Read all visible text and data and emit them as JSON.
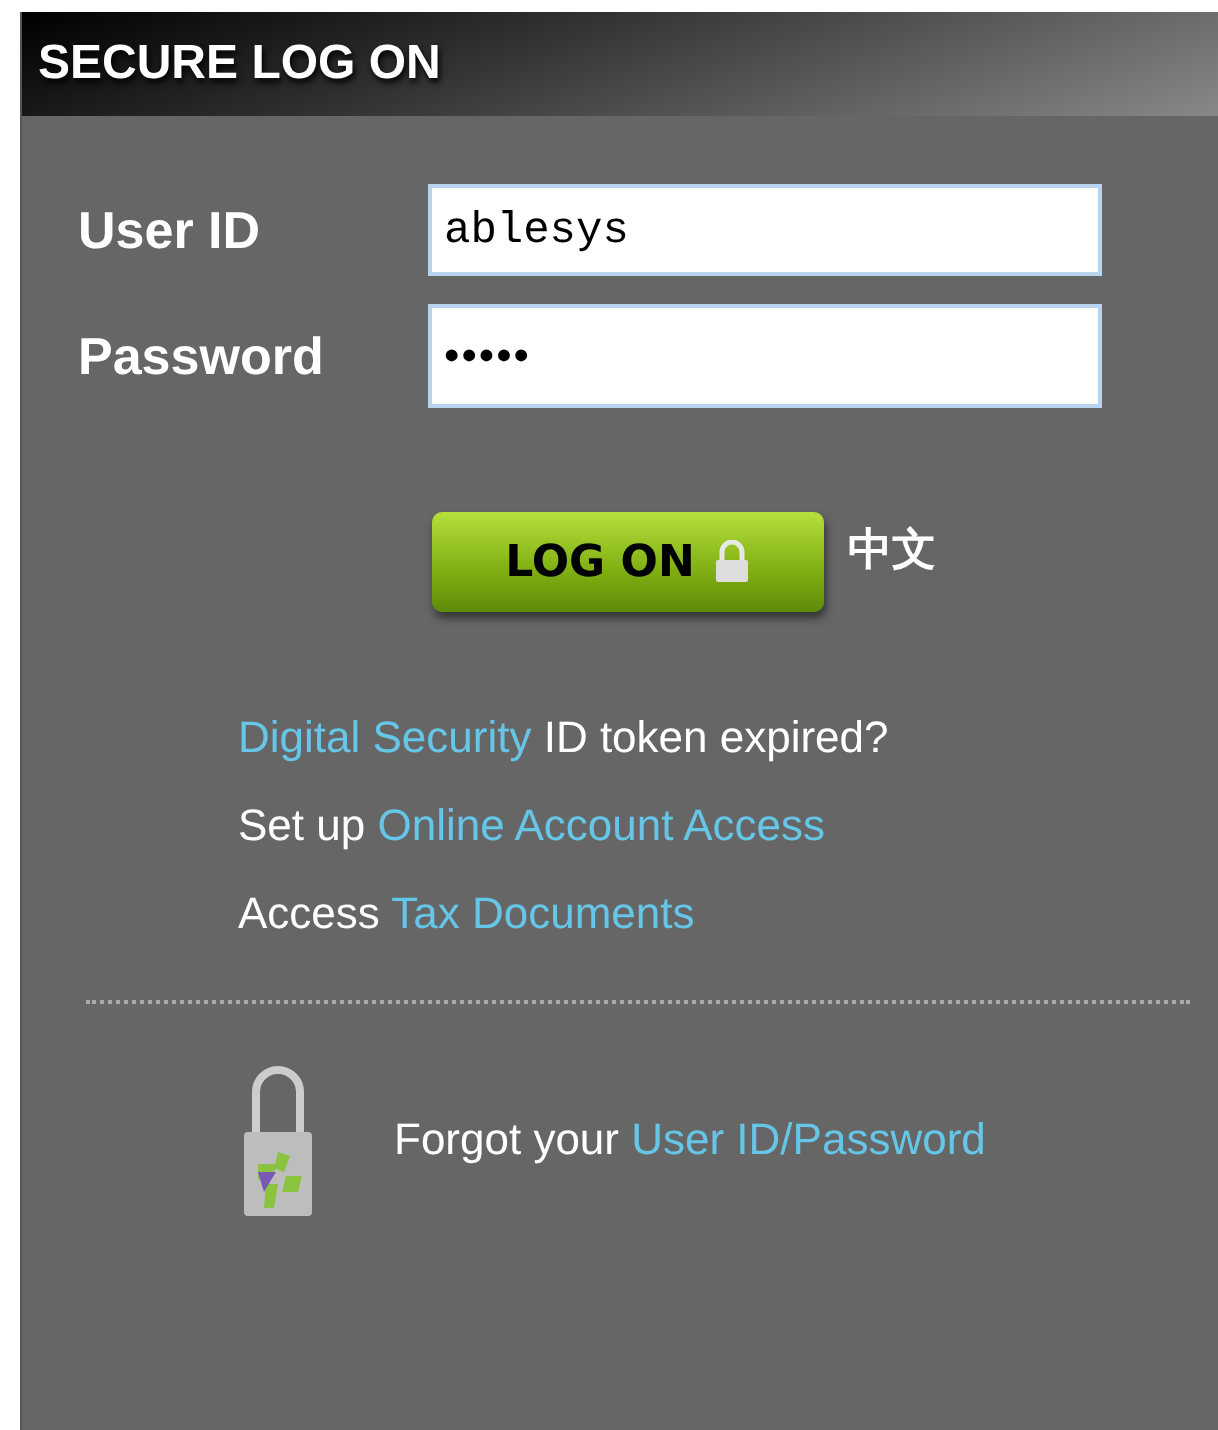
{
  "header": {
    "title": "SECURE LOG ON"
  },
  "fields": [
    {
      "label": "User ID",
      "kind": "text",
      "value": "ablesys"
    },
    {
      "label": "Password",
      "kind": "password",
      "value": "•••••"
    }
  ],
  "log_on_button": {
    "label": "LOG ON"
  },
  "language_link": "中文",
  "links": [
    [
      {
        "kind": "link",
        "text": "Digital Security"
      },
      {
        "kind": "text",
        "text": " ID token expired?"
      }
    ],
    [
      {
        "kind": "text",
        "text": "Set up "
      },
      {
        "kind": "link",
        "text": "Online Account Access"
      }
    ],
    [
      {
        "kind": "text",
        "text": "Access "
      },
      {
        "kind": "link",
        "text": "Tax Documents"
      }
    ]
  ],
  "forgot": [
    {
      "kind": "text",
      "text": "Forgot your "
    },
    {
      "kind": "link",
      "text": "User ID/Password"
    }
  ]
}
